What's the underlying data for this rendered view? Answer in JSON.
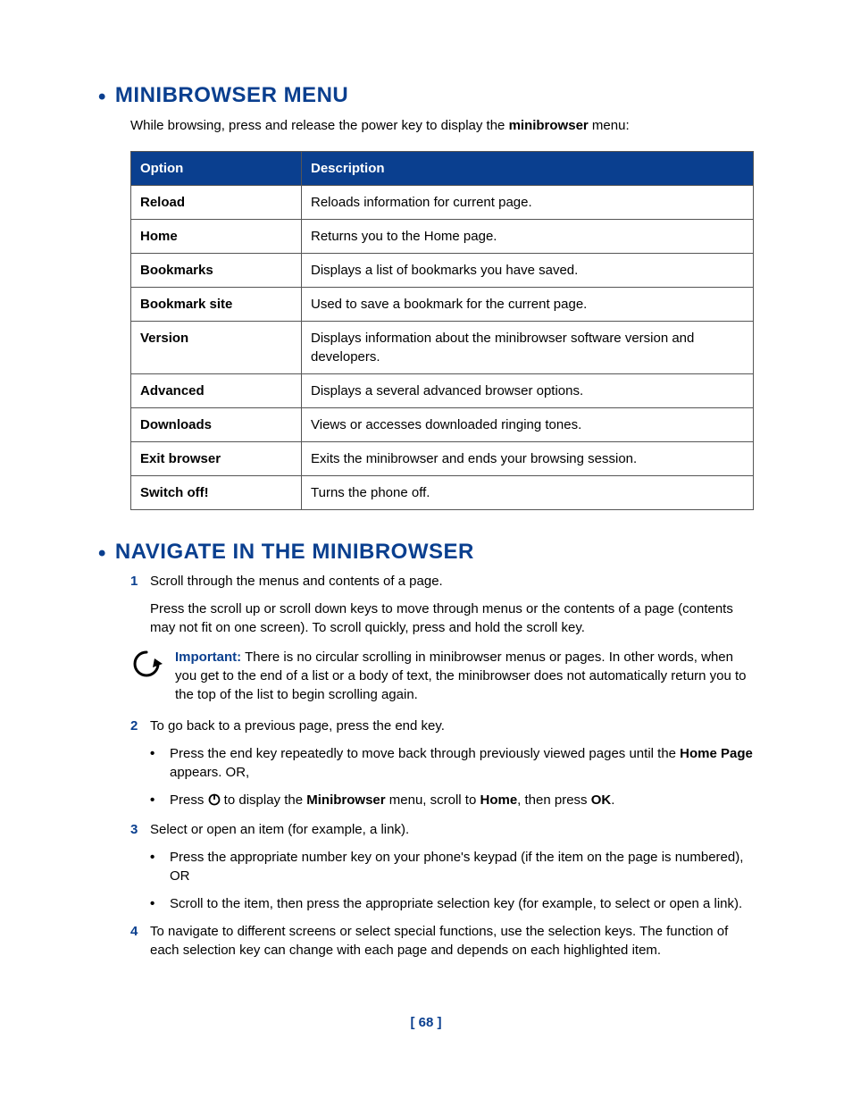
{
  "section1": {
    "heading": "MINIBROWSER MENU",
    "intro_pre": "While browsing, press and release the power key to display the ",
    "intro_bold": "minibrowser",
    "intro_post": " menu:",
    "th_option": "Option",
    "th_desc": "Description",
    "rows": [
      {
        "opt": "Reload",
        "desc": "Reloads information for current page."
      },
      {
        "opt": "Home",
        "desc": "Returns you to the Home page."
      },
      {
        "opt": "Bookmarks",
        "desc": "Displays a list of bookmarks you have saved."
      },
      {
        "opt": "Bookmark site",
        "desc": "Used to save a bookmark for the current page."
      },
      {
        "opt": "Version",
        "desc": "Displays information about the minibrowser software version and developers."
      },
      {
        "opt": "Advanced",
        "desc": "Displays a several advanced browser options."
      },
      {
        "opt": "Downloads",
        "desc": "Views or accesses downloaded ringing tones."
      },
      {
        "opt": "Exit browser",
        "desc": "Exits the minibrowser and ends your browsing session."
      },
      {
        "opt": "Switch off!",
        "desc": "Turns the phone off."
      }
    ]
  },
  "section2": {
    "heading": "NAVIGATE IN THE MINIBROWSER",
    "step1_num": "1",
    "step1_text": "Scroll through the menus and contents of a page.",
    "step1_para": "Press the scroll up or scroll down keys to move through menus or the contents of a page (contents may not fit on one screen). To scroll quickly, press and hold the scroll key.",
    "important_label": "Important:",
    "important_text": " There is no circular scrolling in minibrowser menus or pages. In other words, when you get to the end of a list or a body of text, the minibrowser does not automatically return you to the top of the list to begin scrolling again.",
    "step2_num": "2",
    "step2_text": "To go back to a previous page, press the end key.",
    "step2_sub1_pre": "Press the end key repeatedly to move back through previously viewed pages until the ",
    "step2_sub1_bold": "Home Page",
    "step2_sub1_post": " appears. OR,",
    "step2_sub2_pre": "Press ",
    "step2_sub2_mid1": " to display the ",
    "step2_sub2_b1": "Minibrowser",
    "step2_sub2_mid2": " menu, scroll to ",
    "step2_sub2_b2": "Home",
    "step2_sub2_mid3": ", then press ",
    "step2_sub2_b3": "OK",
    "step2_sub2_post": ".",
    "step3_num": "3",
    "step3_text": "Select or open an item (for example, a link).",
    "step3_sub1": "Press the appropriate number key on your phone's keypad (if the item on the page is numbered), OR",
    "step3_sub2": "Scroll to the item, then press the appropriate selection key (for example, to select or open a link).",
    "step4_num": "4",
    "step4_text": "To navigate to different screens or select special functions, use the selection keys. The function of each selection key can change with each page and depends on each highlighted item."
  },
  "footer": "[ 68 ]"
}
